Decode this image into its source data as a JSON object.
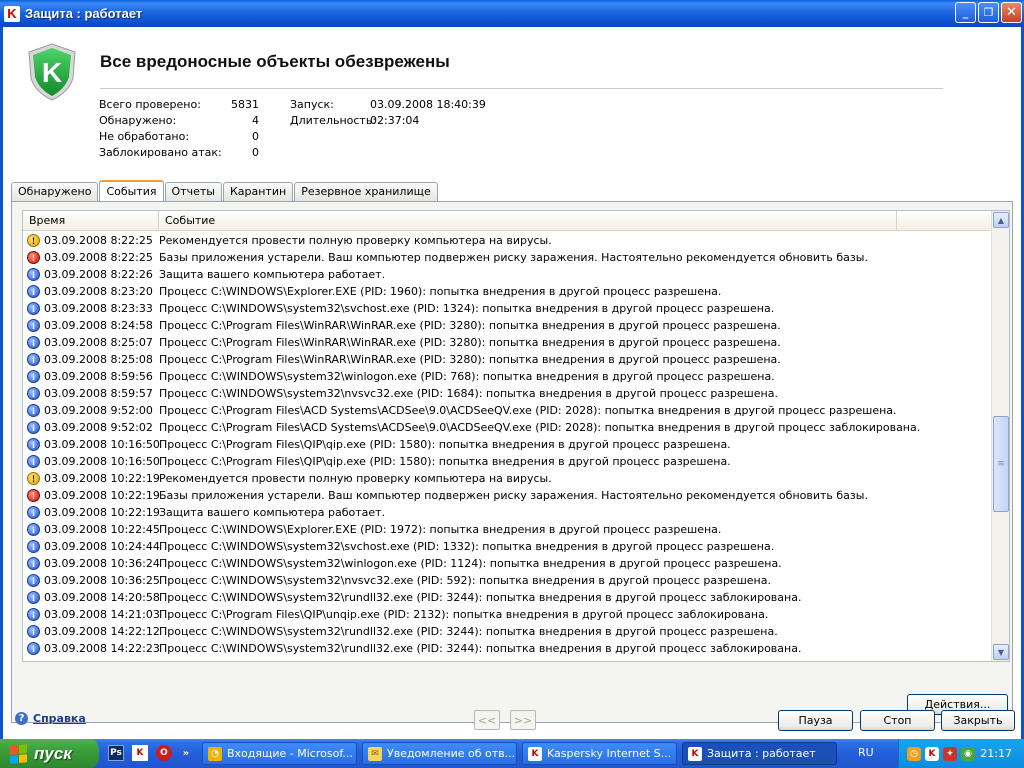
{
  "window": {
    "title": "Защита : работает",
    "app_icon": "kaspersky-k-icon",
    "controls": [
      "minimize",
      "maximize",
      "close"
    ]
  },
  "status": {
    "headline": "Все вредоносные объекты обезврежены",
    "stats": [
      {
        "label": "Всего проверено:",
        "value": "5831"
      },
      {
        "label": "Обнаружено:",
        "value": "4"
      },
      {
        "label": "Не обработано:",
        "value": "0"
      },
      {
        "label": "Заблокировано атак:",
        "value": "0"
      }
    ],
    "session": [
      {
        "label": "Запуск:",
        "value": "03.09.2008 18:40:39"
      },
      {
        "label": "Длительность:",
        "value": "02:37:04"
      }
    ]
  },
  "tabs": [
    {
      "label": "Обнаружено",
      "active": false
    },
    {
      "label": "События",
      "active": true
    },
    {
      "label": "Отчеты",
      "active": false
    },
    {
      "label": "Карантин",
      "active": false
    },
    {
      "label": "Резервное хранилище",
      "active": false
    }
  ],
  "log": {
    "columns": {
      "time": "Время",
      "event": "Событие"
    },
    "rows": [
      {
        "level": "warning",
        "time": "03.09.2008 8:22:25",
        "event": "Рекомендуется провести полную проверку компьютера на вирусы."
      },
      {
        "level": "critical",
        "time": "03.09.2008 8:22:25",
        "event": "Базы приложения устарели. Ваш компьютер подвержен риску заражения. Настоятельно рекомендуется обновить базы."
      },
      {
        "level": "info",
        "time": "03.09.2008 8:22:26",
        "event": "Защита вашего компьютера работает."
      },
      {
        "level": "info",
        "time": "03.09.2008 8:23:20",
        "event": "Процесс C:\\WINDOWS\\Explorer.EXE (PID: 1960): попытка внедрения в другой процесс разрешена."
      },
      {
        "level": "info",
        "time": "03.09.2008 8:23:33",
        "event": "Процесс C:\\WINDOWS\\system32\\svchost.exe (PID: 1324): попытка внедрения в другой процесс разрешена."
      },
      {
        "level": "info",
        "time": "03.09.2008 8:24:58",
        "event": "Процесс C:\\Program Files\\WinRAR\\WinRAR.exe (PID: 3280): попытка внедрения в другой процесс разрешена."
      },
      {
        "level": "info",
        "time": "03.09.2008 8:25:07",
        "event": "Процесс C:\\Program Files\\WinRAR\\WinRAR.exe (PID: 3280): попытка внедрения в другой процесс разрешена."
      },
      {
        "level": "info",
        "time": "03.09.2008 8:25:08",
        "event": "Процесс C:\\Program Files\\WinRAR\\WinRAR.exe (PID: 3280): попытка внедрения в другой процесс разрешена."
      },
      {
        "level": "info",
        "time": "03.09.2008 8:59:56",
        "event": "Процесс C:\\WINDOWS\\system32\\winlogon.exe (PID: 768): попытка внедрения в другой процесс разрешена."
      },
      {
        "level": "info",
        "time": "03.09.2008 8:59:57",
        "event": "Процесс C:\\WINDOWS\\system32\\nvsvc32.exe (PID: 1684): попытка внедрения в другой процесс разрешена."
      },
      {
        "level": "info",
        "time": "03.09.2008 9:52:00",
        "event": "Процесс C:\\Program Files\\ACD Systems\\ACDSee\\9.0\\ACDSeeQV.exe (PID: 2028): попытка внедрения в другой процесс разрешена."
      },
      {
        "level": "info",
        "time": "03.09.2008 9:52:02",
        "event": "Процесс C:\\Program Files\\ACD Systems\\ACDSee\\9.0\\ACDSeeQV.exe (PID: 2028): попытка внедрения в другой процесс заблокирована."
      },
      {
        "level": "info",
        "time": "03.09.2008 10:16:50",
        "event": "Процесс C:\\Program Files\\QIP\\qip.exe (PID: 1580): попытка внедрения в другой процесс разрешена."
      },
      {
        "level": "info",
        "time": "03.09.2008 10:16:50",
        "event": "Процесс C:\\Program Files\\QIP\\qip.exe (PID: 1580): попытка внедрения в другой процесс разрешена."
      },
      {
        "level": "warning",
        "time": "03.09.2008 10:22:19",
        "event": "Рекомендуется провести полную проверку компьютера на вирусы."
      },
      {
        "level": "critical",
        "time": "03.09.2008 10:22:19",
        "event": "Базы приложения устарели. Ваш компьютер подвержен риску заражения. Настоятельно рекомендуется обновить базы."
      },
      {
        "level": "info",
        "time": "03.09.2008 10:22:19",
        "event": "Защита вашего компьютера работает."
      },
      {
        "level": "info",
        "time": "03.09.2008 10:22:45",
        "event": "Процесс C:\\WINDOWS\\Explorer.EXE (PID: 1972): попытка внедрения в другой процесс разрешена."
      },
      {
        "level": "info",
        "time": "03.09.2008 10:24:44",
        "event": "Процесс C:\\WINDOWS\\system32\\svchost.exe (PID: 1332): попытка внедрения в другой процесс разрешена."
      },
      {
        "level": "info",
        "time": "03.09.2008 10:36:24",
        "event": "Процесс C:\\WINDOWS\\system32\\winlogon.exe (PID: 1124): попытка внедрения в другой процесс разрешена."
      },
      {
        "level": "info",
        "time": "03.09.2008 10:36:25",
        "event": "Процесс C:\\WINDOWS\\system32\\nvsvc32.exe (PID: 592): попытка внедрения в другой процесс разрешена."
      },
      {
        "level": "info",
        "time": "03.09.2008 14:20:58",
        "event": "Процесс C:\\WINDOWS\\system32\\rundll32.exe (PID: 3244): попытка внедрения в другой процесс заблокирована."
      },
      {
        "level": "info",
        "time": "03.09.2008 14:21:03",
        "event": "Процесс C:\\Program Files\\QIP\\unqip.exe (PID: 2132): попытка внедрения в другой процесс заблокирована."
      },
      {
        "level": "info",
        "time": "03.09.2008 14:22:12",
        "event": "Процесс C:\\WINDOWS\\system32\\rundll32.exe (PID: 3244): попытка внедрения в другой процесс разрешена."
      },
      {
        "level": "info",
        "time": "03.09.2008 14:22:23",
        "event": "Процесс C:\\WINDOWS\\system32\\rundll32.exe (PID: 3244): попытка внедрения в другой процесс заблокирована."
      }
    ]
  },
  "buttons": {
    "actions": "Действия...",
    "pause": "Пауза",
    "stop": "Стоп",
    "close": "Закрыть",
    "prev": "<<",
    "next": ">>"
  },
  "help": {
    "label": "Справка"
  },
  "taskbar": {
    "start": "пуск",
    "quick_launch": [
      "photoshop-icon",
      "kaspersky-icon",
      "opera-icon"
    ],
    "tasks": [
      {
        "label": "Входящие - Microsof...",
        "icon": "outlook-icon",
        "active": false
      },
      {
        "label": "Уведомление об отв...",
        "icon": "mail-icon",
        "active": false
      },
      {
        "label": "Kaspersky Internet S...",
        "icon": "kaspersky-icon",
        "active": false
      },
      {
        "label": "Защита : работает",
        "icon": "kaspersky-icon",
        "active": true
      }
    ],
    "language": "RU",
    "clock": "21:17"
  }
}
